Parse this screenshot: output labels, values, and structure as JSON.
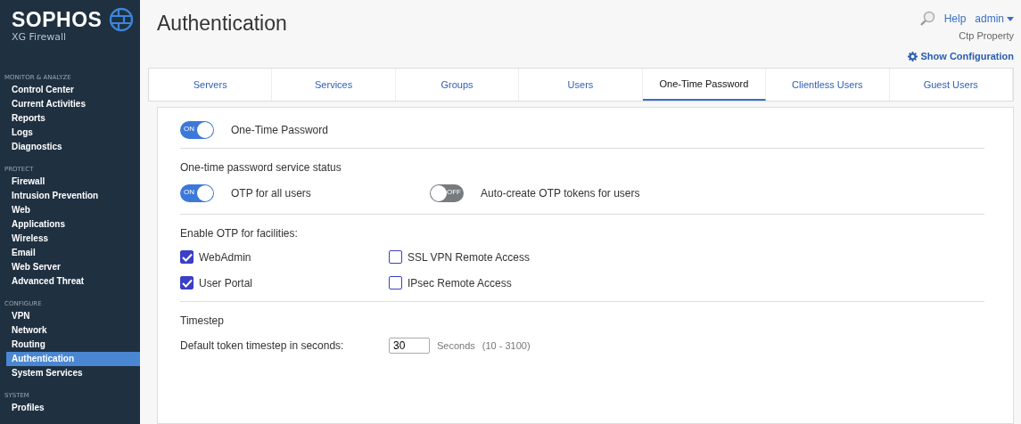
{
  "brand": {
    "name": "SOPHOS",
    "product": "XG Firewall"
  },
  "sidebar": {
    "sections": [
      {
        "heading": "MONITOR & ANALYZE",
        "items": [
          {
            "label": "Control Center",
            "selected": false
          },
          {
            "label": "Current Activities",
            "selected": false
          },
          {
            "label": "Reports",
            "selected": false
          },
          {
            "label": "Logs",
            "selected": false
          },
          {
            "label": "Diagnostics",
            "selected": false
          }
        ]
      },
      {
        "heading": "PROTECT",
        "items": [
          {
            "label": "Firewall",
            "selected": false
          },
          {
            "label": "Intrusion Prevention",
            "selected": false
          },
          {
            "label": "Web",
            "selected": false
          },
          {
            "label": "Applications",
            "selected": false
          },
          {
            "label": "Wireless",
            "selected": false
          },
          {
            "label": "Email",
            "selected": false
          },
          {
            "label": "Web Server",
            "selected": false
          },
          {
            "label": "Advanced Threat",
            "selected": false
          }
        ]
      },
      {
        "heading": "CONFIGURE",
        "items": [
          {
            "label": "VPN",
            "selected": false
          },
          {
            "label": "Network",
            "selected": false
          },
          {
            "label": "Routing",
            "selected": false
          },
          {
            "label": "Authentication",
            "selected": true
          },
          {
            "label": "System Services",
            "selected": false
          }
        ]
      },
      {
        "heading": "SYSTEM",
        "items": [
          {
            "label": "Profiles",
            "selected": false
          }
        ]
      }
    ]
  },
  "page_title": "Authentication",
  "header": {
    "help": "Help",
    "user": "admin",
    "property": "Ctp Property",
    "show_configuration": "Show Configuration"
  },
  "tabs": [
    {
      "label": "Servers",
      "selected": false
    },
    {
      "label": "Services",
      "selected": false
    },
    {
      "label": "Groups",
      "selected": false
    },
    {
      "label": "Users",
      "selected": false
    },
    {
      "label": "One-Time Password",
      "selected": true
    },
    {
      "label": "Clientless Users",
      "selected": false
    },
    {
      "label": "Guest Users",
      "selected": false
    }
  ],
  "otp_toggle": {
    "label": "One-Time Password",
    "on": true,
    "switch_text": "ON"
  },
  "service_status": {
    "heading": "One-time password service status",
    "toggles": [
      {
        "label": "OTP for all users",
        "on": true,
        "switch_text": "ON"
      },
      {
        "label": "Auto-create OTP tokens for users",
        "on": false,
        "switch_text": "OFF"
      }
    ]
  },
  "facilities": {
    "heading": "Enable OTP for facilities:",
    "options": [
      {
        "label": "WebAdmin",
        "checked": true
      },
      {
        "label": "SSL VPN Remote Access",
        "checked": false
      },
      {
        "label": "User Portal",
        "checked": true
      },
      {
        "label": "IPsec Remote Access",
        "checked": false
      }
    ]
  },
  "timestep": {
    "heading": "Timestep",
    "label": "Default token timestep in seconds:",
    "value": "30",
    "unit": "Seconds",
    "range": "(10 - 3100)"
  }
}
